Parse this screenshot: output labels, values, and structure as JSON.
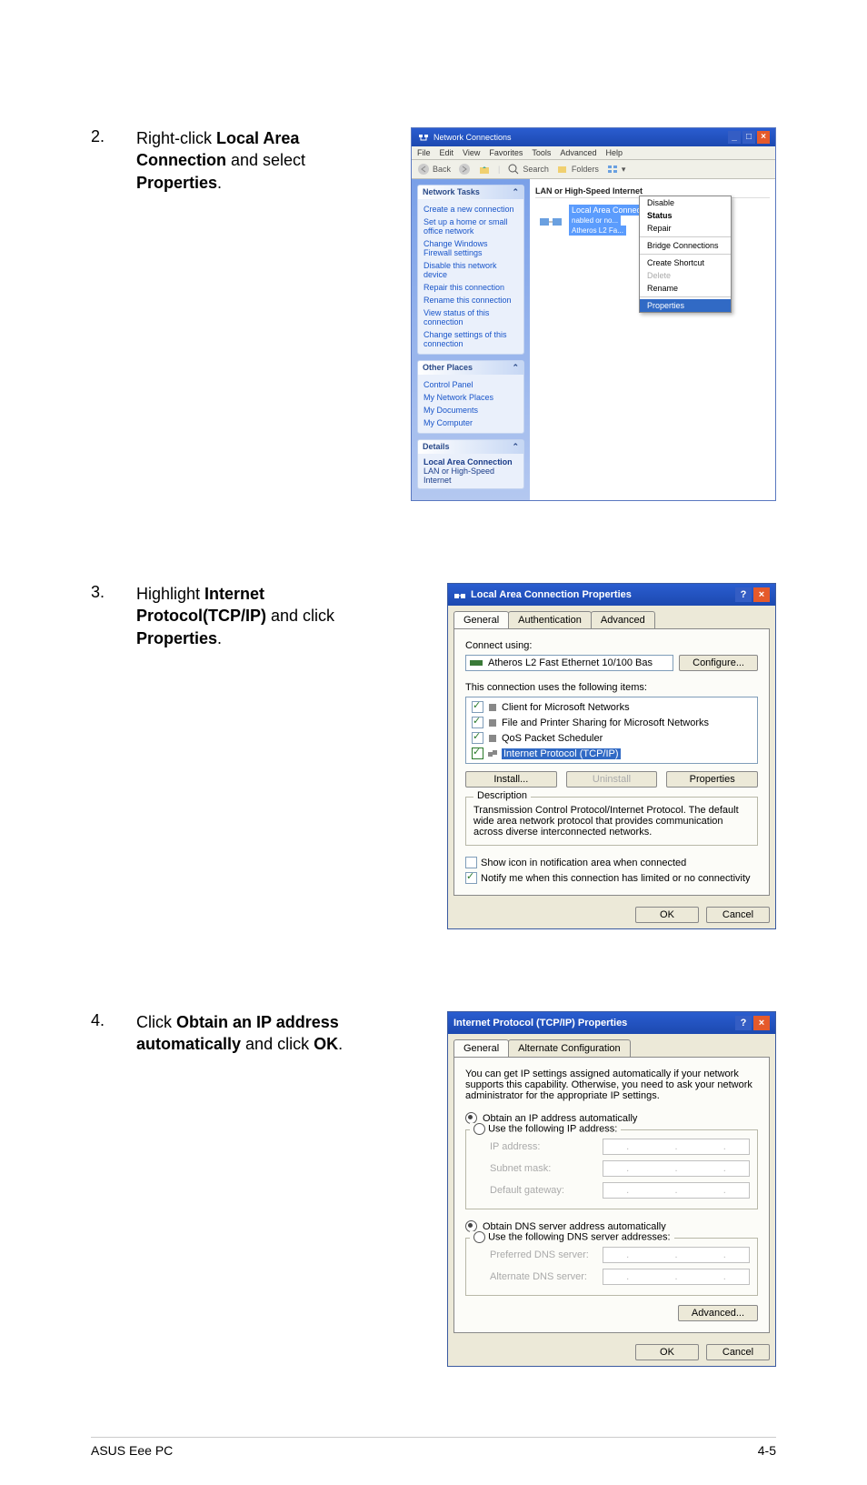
{
  "steps": {
    "s2": {
      "num": "2.",
      "pre": "Right-click ",
      "bold1": "Local Area Connection",
      "mid": " and select ",
      "bold2": "Properties",
      "post": "."
    },
    "s3": {
      "num": "3.",
      "pre": "Highlight ",
      "bold1": "Internet Protocol(TCP/IP)",
      "mid": " and click ",
      "bold2": "Properties",
      "post": "."
    },
    "s4": {
      "num": "4.",
      "pre": "Click ",
      "bold1": "Obtain an IP address automatically",
      "mid": " and click ",
      "bold2": "OK",
      "post": "."
    }
  },
  "win1": {
    "title": "Network Connections",
    "menu": [
      "File",
      "Edit",
      "View",
      "Favorites",
      "Tools",
      "Advanced",
      "Help"
    ],
    "toolbar": {
      "back": "Back",
      "search": "Search",
      "folders": "Folders"
    },
    "section_header": "LAN or High-Speed Internet",
    "connection": "Local Area Connection",
    "adapter_line1": "nabled or no...",
    "adapter_line2": "Atheros L2 Fa...",
    "ctx": [
      "Disable",
      "Status",
      "Repair",
      "Bridge Connections",
      "Create Shortcut",
      "Delete",
      "Rename",
      "Properties"
    ],
    "side": {
      "tasks_h": "Network Tasks",
      "tasks": [
        "Create a new connection",
        "Set up a home or small office network",
        "Change Windows Firewall settings",
        "Disable this network device",
        "Repair this connection",
        "Rename this connection",
        "View status of this connection",
        "Change settings of this connection"
      ],
      "places_h": "Other Places",
      "places": [
        "Control Panel",
        "My Network Places",
        "My Documents",
        "My Computer"
      ],
      "details_h": "Details",
      "details_l1": "Local Area Connection",
      "details_l2": "LAN or High-Speed Internet"
    }
  },
  "dlg2": {
    "title": "Local Area Connection Properties",
    "tabs": [
      "General",
      "Authentication",
      "Advanced"
    ],
    "connect_using": "Connect using:",
    "adapter": "Atheros L2 Fast Ethernet 10/100 Bas",
    "configure": "Configure...",
    "items_label": "This connection uses the following items:",
    "items": [
      "Client for Microsoft Networks",
      "File and Printer Sharing for Microsoft Networks",
      "QoS Packet Scheduler",
      "Internet Protocol (TCP/IP)"
    ],
    "btn_install": "Install...",
    "btn_uninstall": "Uninstall",
    "btn_properties": "Properties",
    "desc_h": "Description",
    "desc": "Transmission Control Protocol/Internet Protocol. The default wide area network protocol that provides communication across diverse interconnected networks.",
    "cb1": "Show icon in notification area when connected",
    "cb2": "Notify me when this connection has limited or no connectivity",
    "ok": "OK",
    "cancel": "Cancel"
  },
  "dlg3": {
    "title": "Internet Protocol (TCP/IP) Properties",
    "tabs": [
      "General",
      "Alternate Configuration"
    ],
    "intro": "You can get IP settings assigned automatically if your network supports this capability. Otherwise, you need to ask your network administrator for the appropriate IP settings.",
    "r1": "Obtain an IP address automatically",
    "r2": "Use the following IP address:",
    "ip": "IP address:",
    "subnet": "Subnet mask:",
    "gateway": "Default gateway:",
    "r3": "Obtain DNS server address automatically",
    "r4": "Use the following DNS server addresses:",
    "dns1": "Preferred DNS server:",
    "dns2": "Alternate DNS server:",
    "advanced": "Advanced...",
    "ok": "OK",
    "cancel": "Cancel"
  },
  "footer": {
    "left": "ASUS Eee PC",
    "right": "4-5"
  }
}
